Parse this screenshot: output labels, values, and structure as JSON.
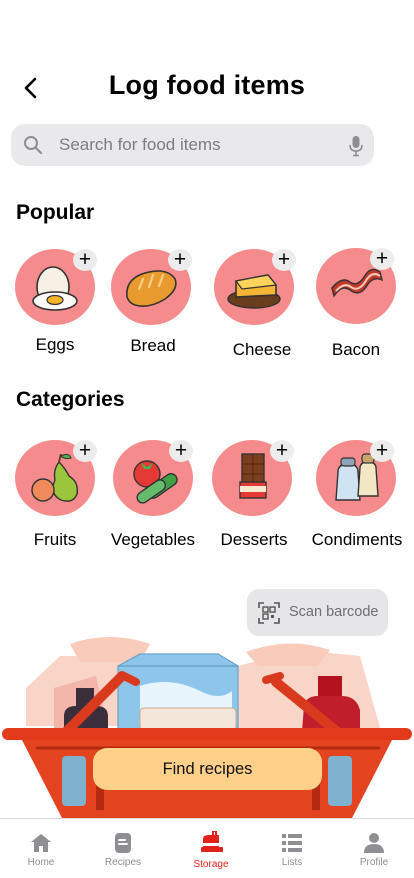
{
  "header": {
    "title": "Log food items"
  },
  "search": {
    "placeholder": "Search for food items"
  },
  "popular": {
    "title": "Popular",
    "items": [
      {
        "label": "Eggs",
        "icon": "egg-icon"
      },
      {
        "label": "Bread",
        "icon": "bread-icon"
      },
      {
        "label": "Cheese",
        "icon": "cheese-icon"
      },
      {
        "label": "Bacon",
        "icon": "bacon-icon"
      }
    ]
  },
  "categories": {
    "title": "Categories",
    "items": [
      {
        "label": "Fruits",
        "icon": "fruits-icon"
      },
      {
        "label": "Vegetables",
        "icon": "vegetables-icon"
      },
      {
        "label": "Desserts",
        "icon": "desserts-icon"
      },
      {
        "label": "Condiments",
        "icon": "condiments-icon"
      }
    ]
  },
  "scan": {
    "label": "Scan barcode"
  },
  "find_button": {
    "label": "Find recipes"
  },
  "tabs": [
    {
      "label": "Home",
      "icon": "home-icon",
      "active": false
    },
    {
      "label": "Recipes",
      "icon": "recipes-icon",
      "active": false
    },
    {
      "label": "Storage",
      "icon": "storage-icon",
      "active": true
    },
    {
      "label": "Lists",
      "icon": "lists-icon",
      "active": false
    },
    {
      "label": "Profile",
      "icon": "profile-icon",
      "active": false
    }
  ],
  "colors": {
    "accent": "#e3231b",
    "food_circle": "#f68b8d",
    "find_button_bg": "#ffd08a",
    "search_bg": "#e9e9eb"
  }
}
